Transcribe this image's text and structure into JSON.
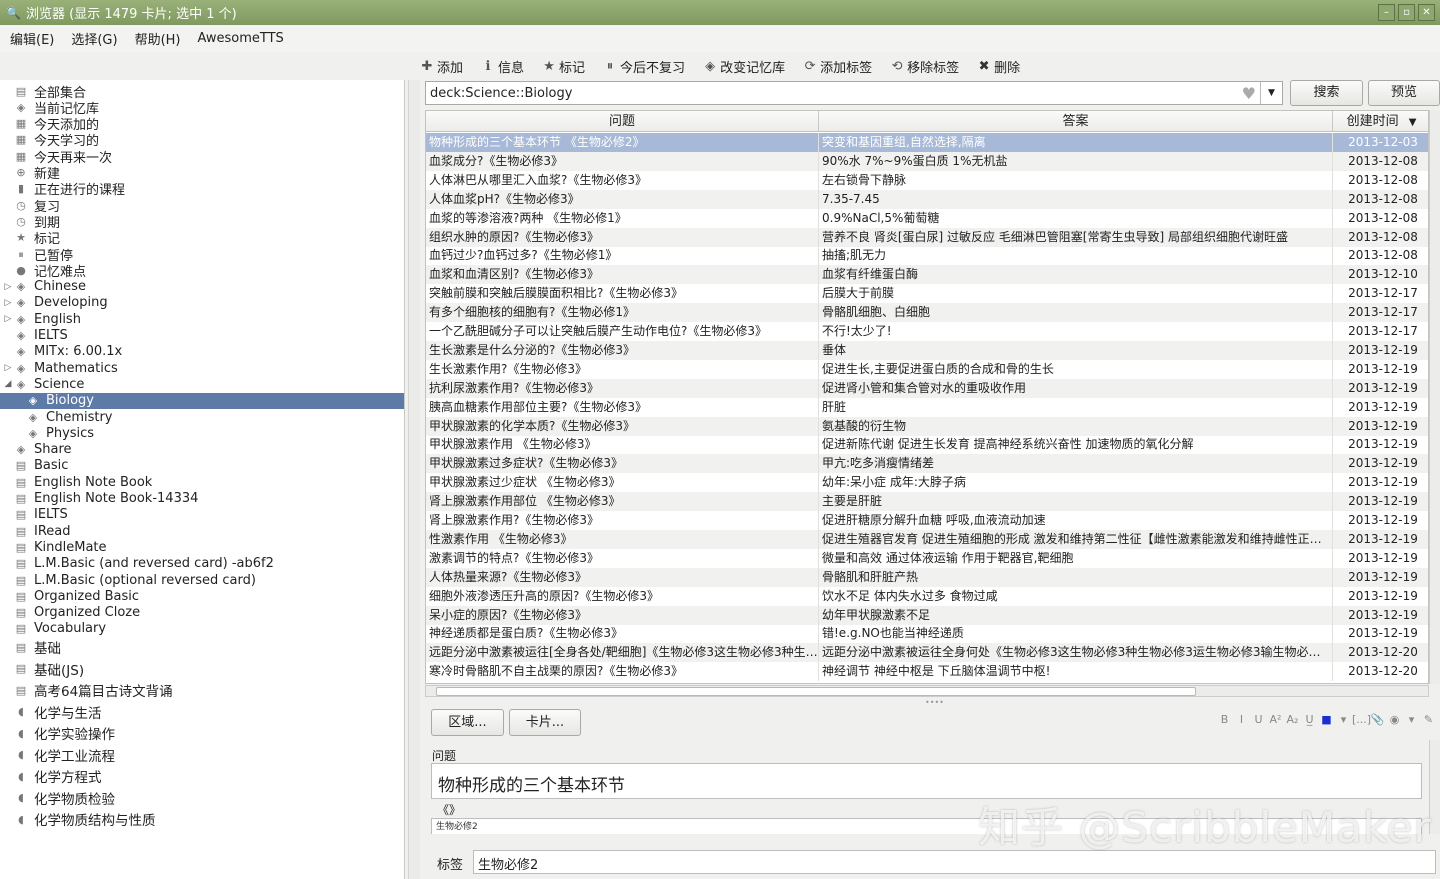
{
  "window": {
    "title": "浏览器 (显示 1479 卡片; 选中 1 个)"
  },
  "menu": [
    "编辑(E)",
    "选择(G)",
    "帮助(H)",
    "AwesomeTTS"
  ],
  "toolbar": [
    {
      "icon": "plus-icon",
      "label": "添加"
    },
    {
      "icon": "info-icon",
      "label": "信息"
    },
    {
      "icon": "star-icon",
      "label": "标记"
    },
    {
      "icon": "pause-icon",
      "label": "今后不复习"
    },
    {
      "icon": "deck-icon",
      "label": "改变记忆库"
    },
    {
      "icon": "tag-add-icon",
      "label": "添加标签"
    },
    {
      "icon": "tag-remove-icon",
      "label": "移除标签"
    },
    {
      "icon": "delete-icon",
      "label": "删除"
    }
  ],
  "search": {
    "value": "deck:Science::Biology",
    "search_label": "搜索",
    "preview_label": "预览"
  },
  "sidebar": [
    {
      "label": "全部集合",
      "icon": "collection-icon",
      "indent": 0
    },
    {
      "label": "当前记忆库",
      "icon": "deck-icon",
      "indent": 0
    },
    {
      "label": "今天添加的",
      "icon": "calendar-icon",
      "indent": 0
    },
    {
      "label": "今天学习的",
      "icon": "calendar-icon",
      "indent": 0
    },
    {
      "label": "今天再来一次",
      "icon": "calendar-icon",
      "indent": 0
    },
    {
      "label": "新建",
      "icon": "new-icon",
      "indent": 0
    },
    {
      "label": "正在进行的课程",
      "icon": "book-icon",
      "indent": 0
    },
    {
      "label": "复习",
      "icon": "clock-icon",
      "indent": 0
    },
    {
      "label": "到期",
      "icon": "clock-icon",
      "indent": 0
    },
    {
      "label": "标记",
      "icon": "star-icon",
      "indent": 0
    },
    {
      "label": "已暂停",
      "icon": "pause-icon",
      "indent": 0
    },
    {
      "label": "记忆难点",
      "icon": "leech-icon",
      "indent": 0
    },
    {
      "label": "Chinese",
      "icon": "deck-icon",
      "indent": 0,
      "arrow": "right"
    },
    {
      "label": "Developing",
      "icon": "deck-icon",
      "indent": 0,
      "arrow": "right"
    },
    {
      "label": "English",
      "icon": "deck-icon",
      "indent": 0,
      "arrow": "right"
    },
    {
      "label": "IELTS",
      "icon": "deck-icon",
      "indent": 0
    },
    {
      "label": "MITx: 6.00.1x",
      "icon": "deck-icon",
      "indent": 0
    },
    {
      "label": "Mathematics",
      "icon": "deck-icon",
      "indent": 0,
      "arrow": "right"
    },
    {
      "label": "Science",
      "icon": "deck-icon",
      "indent": 0,
      "arrow": "down"
    },
    {
      "label": "Biology",
      "icon": "deck-icon",
      "indent": 1,
      "selected": true
    },
    {
      "label": "Chemistry",
      "icon": "deck-icon",
      "indent": 1
    },
    {
      "label": "Physics",
      "icon": "deck-icon",
      "indent": 1
    },
    {
      "label": "Share",
      "icon": "deck-icon",
      "indent": 0
    },
    {
      "label": "Basic",
      "icon": "notetype-icon",
      "indent": 0
    },
    {
      "label": "English Note Book",
      "icon": "notetype-icon",
      "indent": 0
    },
    {
      "label": "English Note Book-14334",
      "icon": "notetype-icon",
      "indent": 0
    },
    {
      "label": "IELTS",
      "icon": "notetype-icon",
      "indent": 0
    },
    {
      "label": "IRead",
      "icon": "notetype-icon",
      "indent": 0
    },
    {
      "label": "KindleMate",
      "icon": "notetype-icon",
      "indent": 0
    },
    {
      "label": "L.M.Basic (and reversed card) -ab6f2",
      "icon": "notetype-icon",
      "indent": 0
    },
    {
      "label": "L.M.Basic (optional reversed card)",
      "icon": "notetype-icon",
      "indent": 0
    },
    {
      "label": "Organized Basic",
      "icon": "notetype-icon",
      "indent": 0
    },
    {
      "label": "Organized Cloze",
      "icon": "notetype-icon",
      "indent": 0
    },
    {
      "label": "Vocabulary",
      "icon": "notetype-icon",
      "indent": 0
    },
    {
      "label": "基础",
      "icon": "notetype-icon",
      "indent": 0,
      "big": true
    },
    {
      "label": "基础(JS)",
      "icon": "notetype-icon",
      "indent": 0,
      "big": true
    },
    {
      "label": "高考64篇目古诗文背诵",
      "icon": "notetype-icon",
      "indent": 0,
      "big": true
    },
    {
      "label": "化学与生活",
      "icon": "tag-icon",
      "indent": 0,
      "big": true
    },
    {
      "label": "化学实验操作",
      "icon": "tag-icon",
      "indent": 0,
      "big": true
    },
    {
      "label": "化学工业流程",
      "icon": "tag-icon",
      "indent": 0,
      "big": true
    },
    {
      "label": "化学方程式",
      "icon": "tag-icon",
      "indent": 0,
      "big": true
    },
    {
      "label": "化学物质检验",
      "icon": "tag-icon",
      "indent": 0,
      "big": true
    },
    {
      "label": "化学物质结构与性质",
      "icon": "tag-icon",
      "indent": 0,
      "big": true
    }
  ],
  "table": {
    "columns": [
      "问题",
      "答案",
      "创建时间"
    ],
    "rows": [
      [
        "物种形成的三个基本环节 《生物必修2》",
        "突变和基因重组,自然选择,隔离",
        "2013-12-03"
      ],
      [
        "血浆成分?《生物必修3》",
        "90%水 7%~9%蛋白质 1%无机盐",
        "2013-12-08"
      ],
      [
        "人体淋巴从哪里汇入血浆?《生物必修3》",
        "左右锁骨下静脉",
        "2013-12-08"
      ],
      [
        "人体血浆pH?《生物必修3》",
        "7.35-7.45",
        "2013-12-08"
      ],
      [
        "血浆的等渗溶液?两种 《生物必修1》",
        "0.9%NaCl,5%葡萄糖",
        "2013-12-08"
      ],
      [
        "组织水肿的原因?《生物必修3》",
        "营养不良 肾炎[蛋白尿] 过敏反应 毛细淋巴管阻塞[常寄生虫导致] 局部组织细胞代谢旺盛",
        "2013-12-08"
      ],
      [
        "血钙过少?血钙过多?《生物必修1》",
        "抽搐;肌无力",
        "2013-12-08"
      ],
      [
        "血浆和血清区别?《生物必修3》",
        "血浆有纤维蛋白酶",
        "2013-12-10"
      ],
      [
        "突触前膜和突触后膜膜面积相比?《生物必修3》",
        "后膜大于前膜",
        "2013-12-17"
      ],
      [
        "有多个细胞核的细胞有?《生物必修1》",
        "骨骼肌细胞、白细胞",
        "2013-12-17"
      ],
      [
        "一个乙酰胆碱分子可以让突触后膜产生动作电位?《生物必修3》",
        "不行!太少了!",
        "2013-12-17"
      ],
      [
        "生长激素是什么分泌的?《生物必修3》",
        "垂体",
        "2013-12-19"
      ],
      [
        "生长激素作用?《生物必修3》",
        "促进生长,主要促进蛋白质的合成和骨的生长",
        "2013-12-19"
      ],
      [
        "抗利尿激素作用?《生物必修3》",
        "促进肾小管和集合管对水的重吸收作用",
        "2013-12-19"
      ],
      [
        "胰高血糖素作用部位主要?《生物必修3》",
        "肝脏",
        "2013-12-19"
      ],
      [
        "甲状腺激素的化学本质?《生物必修3》",
        "氨基酸的衍生物",
        "2013-12-19"
      ],
      [
        "甲状腺激素作用 《生物必修3》",
        "促进新陈代谢 促进生长发育 提高神经系统兴奋性 加速物质的氧化分解",
        "2013-12-19"
      ],
      [
        "甲状腺激素过多症状?《生物必修3》",
        "甲亢:吃多消瘦情绪差",
        "2013-12-19"
      ],
      [
        "甲状腺激素过少症状 《生物必修3》",
        "幼年:呆小症 成年:大脖子病",
        "2013-12-19"
      ],
      [
        "肾上腺激素作用部位 《生物必修3》",
        "主要是肝脏",
        "2013-12-19"
      ],
      [
        "肾上腺激素作用?《生物必修3》",
        "促进肝糖原分解升血糖 呼吸,血液流动加速",
        "2013-12-19"
      ],
      [
        "性激素作用 《生物必修3》",
        "促进生殖器官发育 促进生殖细胞的形成 激发和维持第二性征【雌性激素能激发和维持雌性正常…",
        "2013-12-19"
      ],
      [
        "激素调节的特点?《生物必修3》",
        "微量和高效 通过体液运输 作用于靶器官,靶细胞",
        "2013-12-19"
      ],
      [
        "人体热量来源?《生物必修3》",
        "骨骼肌和肝脏产热",
        "2013-12-19"
      ],
      [
        "细胞外液渗透压升高的原因?《生物必修3》",
        "饮水不足 体内失水过多 食物过咸",
        "2013-12-19"
      ],
      [
        "呆小症的原因?《生物必修3》",
        "幼年甲状腺激素不足",
        "2013-12-19"
      ],
      [
        "神经递质都是蛋白质?《生物必修3》",
        "错!e.g.NO也能当神经递质",
        "2013-12-19"
      ],
      [
        "远距分泌中激素被运往[全身各处/靶细胞]《生物必修3这生物必修3种生…",
        "远距分泌中激素被运往全身何处《生物必修3这生物必修3种生物必修3运生物必修3输生物必修…",
        "2013-12-20"
      ],
      [
        "寒冷时骨骼肌不自主战栗的原因?《生物必修3》",
        "神经调节 神经中枢是 下丘脑体温调节中枢!",
        "2013-12-20"
      ]
    ]
  },
  "editor": {
    "region_button": "区域...",
    "card_button": "卡片...",
    "field_label": "问题",
    "field_value": "物种形成的三个基本环节",
    "field2_marker": "《》",
    "field2_value": "生物必修2",
    "tags_label": "标签",
    "tags_value": "生物必修2",
    "format_icons": [
      "B",
      "I",
      "U",
      "A²",
      "A₂",
      "U̲",
      "■",
      "▾",
      "[...]",
      "📎",
      "◉",
      "▾",
      "✎"
    ]
  },
  "watermark": "知乎 @ScribbleMaker"
}
